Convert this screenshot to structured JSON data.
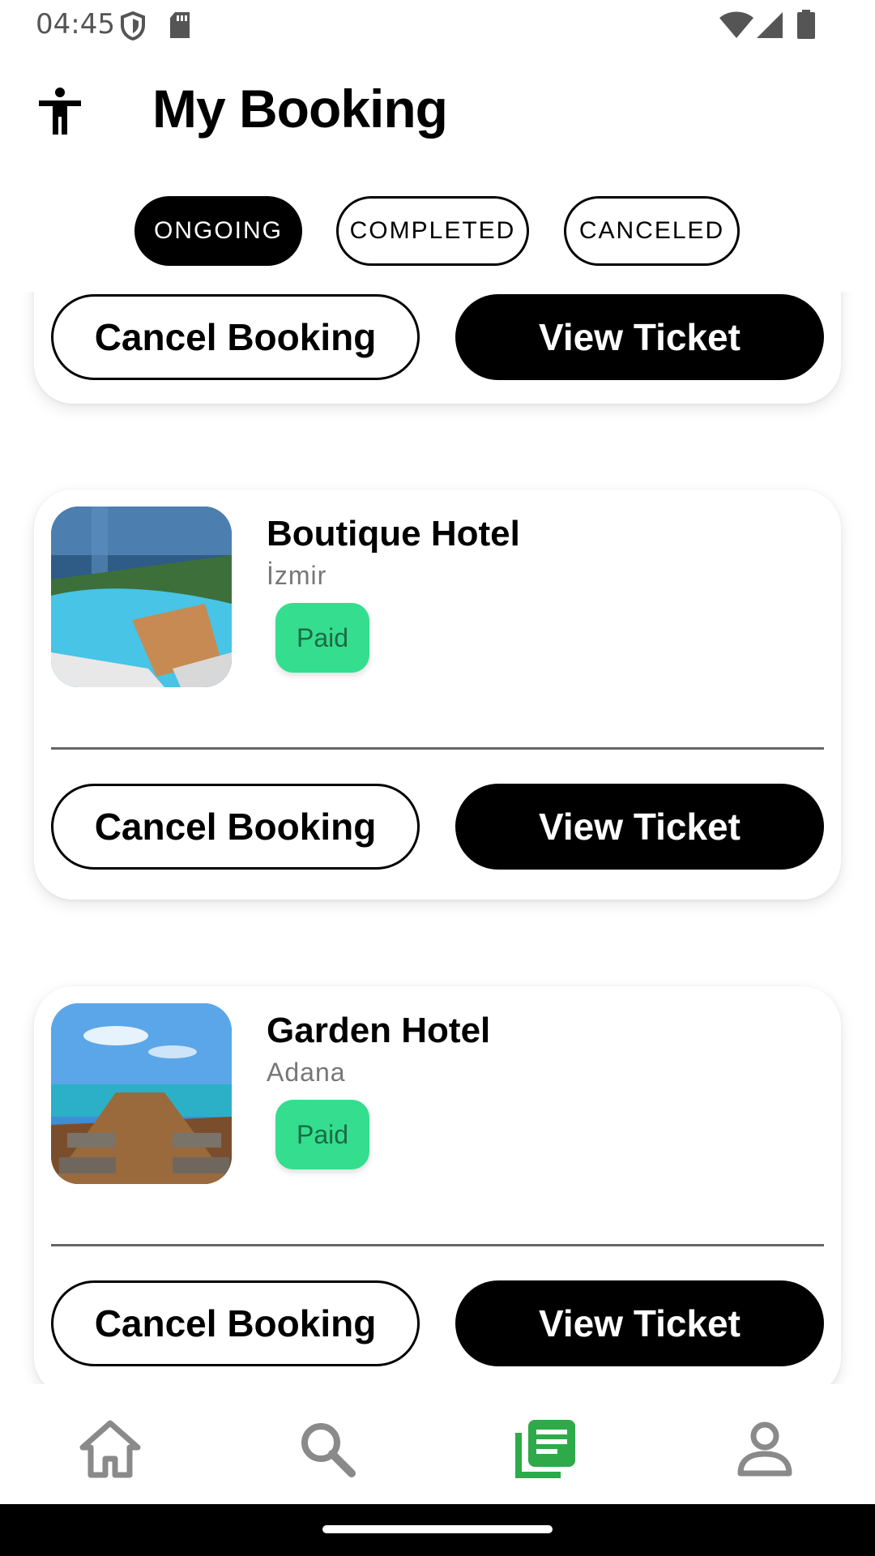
{
  "status_bar": {
    "time": "04:45",
    "icons": [
      "shield-icon",
      "sd-card-icon",
      "wifi-icon",
      "signal-icon",
      "battery-icon"
    ]
  },
  "header": {
    "title": "My Booking",
    "icon": "accessibility-icon"
  },
  "tabs": [
    {
      "label": "ONGOING",
      "active": true
    },
    {
      "label": "COMPLETED",
      "active": false
    },
    {
      "label": "CANCELED",
      "active": false
    }
  ],
  "bookings": [
    {
      "name": "",
      "city": "",
      "status": "",
      "cancel_label": "Cancel Booking",
      "view_label": "View Ticket"
    },
    {
      "name": "Boutique Hotel",
      "city": "İzmir",
      "status": "Paid",
      "cancel_label": "Cancel Booking",
      "view_label": "View Ticket"
    },
    {
      "name": "Garden Hotel",
      "city": "Adana",
      "status": "Paid",
      "cancel_label": "Cancel Booking",
      "view_label": "View Ticket"
    }
  ],
  "bottom_nav": {
    "items": [
      "home-icon",
      "search-icon",
      "bookings-icon",
      "profile-icon"
    ],
    "active_index": 2,
    "active_color": "#2eaa4a",
    "inactive_color": "#8a8a8a"
  },
  "colors": {
    "paid_badge": "#34de8e",
    "primary": "#000000"
  }
}
